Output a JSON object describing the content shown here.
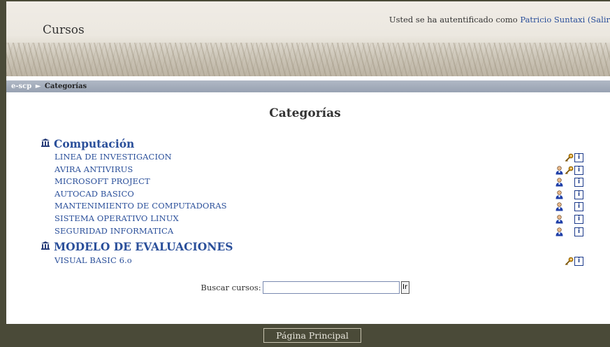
{
  "header": {
    "site_title": "Cursos",
    "login_prefix": "Usted se ha autentificado como",
    "user_name": "Patricio Suntaxi",
    "logout_text": "(Salir"
  },
  "breadcrumb": {
    "home": "e-scp",
    "separator": "►",
    "current": "Categorías"
  },
  "page_heading": "Categorías",
  "categories": [
    {
      "name": "Computación",
      "courses": [
        {
          "name": "LINEA DE INVESTIGACION",
          "icons": [
            "key-icon",
            "info-icon"
          ]
        },
        {
          "name": "AVIRA ANTIVIRUS",
          "icons": [
            "teacher-icon",
            "key-icon",
            "info-icon"
          ]
        },
        {
          "name": "MICROSOFT PROJECT",
          "icons": [
            "teacher-icon",
            "info-icon"
          ]
        },
        {
          "name": "AUTOCAD BASICO",
          "icons": [
            "teacher-icon",
            "info-icon"
          ]
        },
        {
          "name": "MANTENIMIENTO DE COMPUTADORAS",
          "icons": [
            "teacher-icon",
            "info-icon"
          ]
        },
        {
          "name": "SISTEMA OPERATIVO LINUX",
          "icons": [
            "teacher-icon",
            "info-icon"
          ]
        },
        {
          "name": "SEGURIDAD INFORMATICA",
          "icons": [
            "teacher-icon",
            "info-icon"
          ]
        }
      ]
    },
    {
      "name": "MODELO DE EVALUACIONES",
      "courses": [
        {
          "name": "VISUAL BASIC 6.o",
          "icons": [
            "key-icon",
            "info-icon"
          ]
        }
      ]
    }
  ],
  "search": {
    "label": "Buscar cursos:",
    "value": "",
    "button": "Ir"
  },
  "footer": {
    "home_button": "Página Principal"
  },
  "colors": {
    "link": "#2a4f9a",
    "frame": "#4a4a38",
    "navbar": "#a4acbb"
  }
}
